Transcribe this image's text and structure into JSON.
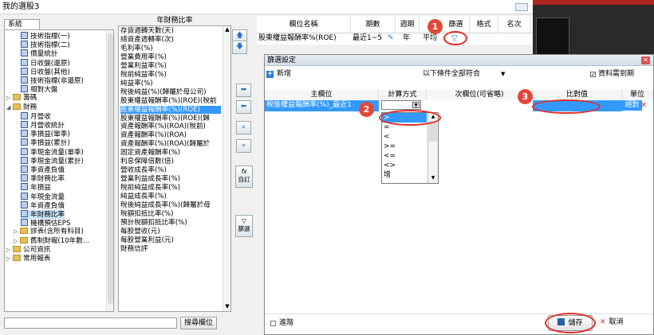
{
  "window": {
    "title": "我的選股3"
  },
  "tree": {
    "tab": "系統",
    "items": [
      {
        "label": "技術指標(一)",
        "type": "table",
        "indent": 2
      },
      {
        "label": "技術指標(二)",
        "type": "table",
        "indent": 2
      },
      {
        "label": "價量統計",
        "type": "table",
        "indent": 2
      },
      {
        "label": "日收盤(還原)",
        "type": "table",
        "indent": 2
      },
      {
        "label": "日收盤(其他)",
        "type": "table",
        "indent": 2
      },
      {
        "label": "技術指標(非還原)",
        "type": "table",
        "indent": 2
      },
      {
        "label": "相對大盤",
        "type": "table",
        "indent": 2
      },
      {
        "label": "籌碼",
        "type": "folder",
        "indent": 0,
        "expanded": false
      },
      {
        "label": "財務",
        "type": "folder",
        "indent": 0,
        "expanded": true
      },
      {
        "label": "月營收",
        "type": "table",
        "indent": 2
      },
      {
        "label": "月營收統計",
        "type": "table",
        "indent": 2
      },
      {
        "label": "季損益(單季)",
        "type": "table",
        "indent": 2
      },
      {
        "label": "季損益(累計)",
        "type": "table",
        "indent": 2
      },
      {
        "label": "季現金流量(單季)",
        "type": "table",
        "indent": 2
      },
      {
        "label": "季現金流量(累計)",
        "type": "table",
        "indent": 2
      },
      {
        "label": "季資產負債",
        "type": "table",
        "indent": 2
      },
      {
        "label": "季財務比率",
        "type": "table",
        "indent": 2
      },
      {
        "label": "年損益",
        "type": "table",
        "indent": 2
      },
      {
        "label": "年現金流量",
        "type": "table",
        "indent": 2
      },
      {
        "label": "年資產負債",
        "type": "table",
        "indent": 2
      },
      {
        "label": "年財務比率",
        "type": "table",
        "indent": 2,
        "selected": true
      },
      {
        "label": "機構預估EPS",
        "type": "table",
        "indent": 2
      },
      {
        "label": "詳表(含所有科目)",
        "type": "folder",
        "indent": 1,
        "expanded": false
      },
      {
        "label": "舊制財報(10年數...",
        "type": "folder",
        "indent": 1,
        "expanded": false
      },
      {
        "label": "公司資訊",
        "type": "folder",
        "indent": 0,
        "expanded": false
      },
      {
        "label": "常用報表",
        "type": "folder",
        "indent": 0,
        "expanded": false
      }
    ],
    "search_button": "搜尋欄位"
  },
  "fields": {
    "header": "年財務比率",
    "items": [
      "存貨週轉天數(天)",
      "總資產週轉率(次)",
      "毛利率(%)",
      "營業費用率(%)",
      "營業利益率(%)",
      "稅前純益率(%)",
      "純益率(%)",
      "稅後純益(%)(歸屬於母公司)",
      "股東權益報酬率(%)(ROE)(稅前",
      "股東權益報酬率(%)(ROE)",
      "股東權益報酬率(%)(ROE)(歸",
      "資產報酬率(%)(ROA)(稅前)",
      "資產報酬率(%)(ROA)",
      "資產報酬率(%)(ROA)(歸屬於",
      "固定資產報酬率(%)",
      "利息保障倍數(倍)",
      "營收成長率(%)",
      "營業利益成長率(%)",
      "稅前純益成長率(%)",
      "純益成長率(%)",
      "稅後純益成長率(%)(歸屬於母",
      "稅額扣抵比率(%)",
      "預計稅額扣抵比率(%)",
      "每股營收(元)",
      "每股營業利益(元)",
      "財務信評"
    ],
    "selected_index": 9
  },
  "middle_buttons": {
    "custom": "自訂",
    "filter": "篩選"
  },
  "grid": {
    "columns": [
      "欄位名稱",
      "期數",
      "週期",
      "篩選",
      "格式",
      "名次"
    ],
    "row": {
      "name": "股東權益報酬率%(ROE)",
      "periods": "最近1~5",
      "cycle": "年",
      "format": "平均"
    }
  },
  "annotations": [
    "1",
    "2",
    "3"
  ],
  "dialog": {
    "title": "篩選設定",
    "add_button": "新增",
    "condition_label": "以下條件全部符合",
    "data_complete_label": "資料需到期",
    "data_complete_checked": true,
    "columns": [
      "主欄位",
      "計算方式",
      "次欄位(可省略)",
      "比對值",
      "單位"
    ],
    "row": {
      "main": "稅後權益報酬率(%)_最近1",
      "unit": "絕對值"
    },
    "operators": [
      ">",
      "=",
      "<",
      ">=",
      "<=",
      "<>",
      "增"
    ],
    "advanced_label": "進階",
    "save_button": "儲存",
    "cancel_button": "取消"
  },
  "colors": {
    "accent": "#3399ff",
    "annotation": "#e0493a",
    "close": "#d9534f"
  }
}
